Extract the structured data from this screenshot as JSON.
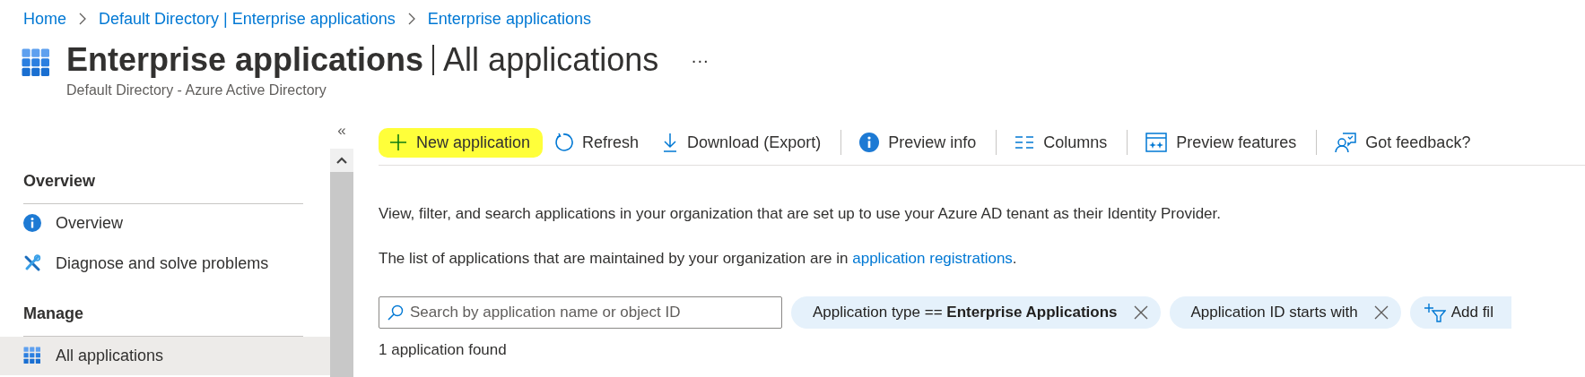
{
  "breadcrumb": [
    "Home",
    "Default Directory | Enterprise applications",
    "Enterprise applications"
  ],
  "header": {
    "title": "Enterprise applications",
    "subtitle_part": "All applications",
    "more": "···",
    "description": "Default Directory - Azure Active Directory"
  },
  "sidebar": {
    "collapse": "«",
    "sections": [
      {
        "title": "Overview",
        "items": [
          {
            "label": "Overview",
            "selected": false
          },
          {
            "label": "Diagnose and solve problems",
            "selected": false
          }
        ]
      },
      {
        "title": "Manage",
        "items": [
          {
            "label": "All applications",
            "selected": true
          }
        ]
      }
    ]
  },
  "toolbar": [
    {
      "label": "New application",
      "highlighted": true
    },
    {
      "label": "Refresh",
      "highlighted": false
    },
    {
      "label": "Download (Export)",
      "highlighted": false
    },
    {
      "label": "Preview info",
      "highlighted": false
    },
    {
      "label": "Columns",
      "highlighted": false
    },
    {
      "label": "Preview features",
      "highlighted": false
    },
    {
      "label": "Got feedback?",
      "highlighted": false
    }
  ],
  "intro": "View, filter, and search applications in your organization that are set up to use your Azure AD tenant as their Identity Provider.",
  "registrations_note": {
    "text": "The list of applications that are maintained by your organization are in ",
    "link": "application registrations",
    "after": "."
  },
  "search": {
    "placeholder": "Search by application name or object ID"
  },
  "filters": [
    {
      "kind": "filter",
      "label": "Application type == **Enterprise Applications**"
    },
    {
      "kind": "filter",
      "label": "Application ID starts with"
    },
    {
      "kind": "add",
      "label": "Add fil"
    }
  ],
  "result_count": "1 application found"
}
